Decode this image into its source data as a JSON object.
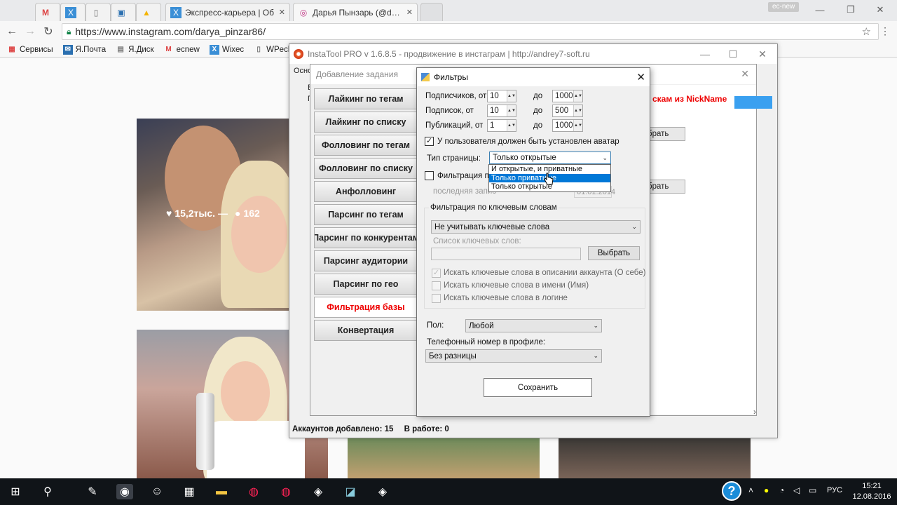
{
  "browser": {
    "tabs": [
      {
        "label": "",
        "icon": "gmail-icon"
      },
      {
        "label": "",
        "icon": "wix-icon"
      },
      {
        "label": "",
        "icon": "document-icon"
      },
      {
        "label": "",
        "icon": "screen-icon"
      },
      {
        "label": "",
        "icon": "drive-icon"
      },
      {
        "label": "Экспресс-карьера | Об",
        "icon": "wix-icon"
      },
      {
        "label": "Дарья Пынзарь (@darya",
        "icon": "instagram-icon"
      }
    ],
    "profile_badge": "ec-new",
    "url": "https://www.instagram.com/darya_pinzar86/",
    "bookmarks": [
      {
        "label": "Сервисы",
        "icon": "apps-icon"
      },
      {
        "label": "Я.Почта",
        "icon": "yandex-mail-icon"
      },
      {
        "label": "Я.Диск",
        "icon": "yandex-disk-icon"
      },
      {
        "label": "ecnew",
        "icon": "gmail-icon"
      },
      {
        "label": "Wixec",
        "icon": "wix-icon"
      },
      {
        "label": "WPecbiz",
        "icon": "document-icon"
      }
    ]
  },
  "instagram": {
    "photo1_likes": "15,2тыс. —",
    "photo1_comments": "162"
  },
  "instatool": {
    "title": "InstaTool PRO v 1.6.8.5 - продвижение в инстаграм | http://andrey7-soft.ru",
    "tabs_hint": "Осно",
    "status_accounts": "Аккаунтов добавлено: 15",
    "status_work": "В работе: 0"
  },
  "add_task": {
    "title": "Добавление задания",
    "buttons": [
      "Лайкинг по тегам",
      "Лайкинг по списку",
      "Фолловинг по тегам",
      "Фолловинг по списку",
      "Анфолловинг",
      "Парсинг по тегам",
      "Парсинг по конкурентам",
      "Парсинг аудитории",
      "Парсинг по гео",
      "Фильтрация базы",
      "Конвертация"
    ],
    "active_index": 9,
    "nick_label": "скам из NickName",
    "choose_label": "брать",
    "choose_label2": "брать",
    "left_letters_1": "В",
    "left_letters_2": "П"
  },
  "filters": {
    "title": "Фильтры",
    "followers_from_label": "Подписчиков, от",
    "followers_from": "10",
    "followers_to": "1000",
    "following_from_label": "Подписок, от",
    "following_from": "10",
    "following_to": "500",
    "posts_from_label": "Публикаций, от",
    "posts_from": "1",
    "posts_to": "1000",
    "to_label": "до",
    "avatar_label": "У пользователя должен быть установлен аватар",
    "page_type_label": "Тип страницы:",
    "page_type_value": "Только открытые",
    "page_type_options": [
      "И открытые, и приватные",
      "Только приватные",
      "Только открытые"
    ],
    "page_type_highlight": 1,
    "filter_date_label": "Фильтрация по",
    "last_post_label": "последняя запис",
    "last_post_date": "01.01.2014",
    "keywords_group": "Фильтрация по ключевым словам",
    "keywords_mode": "Не учитывать ключевые слова",
    "keywords_list_label": "Список ключевых слов:",
    "choose_button": "Выбрать",
    "kw_option_1": "Искать ключевые слова в описании аккаунта (О себе)",
    "kw_option_2": "Искать ключевые слова в имени (Имя)",
    "kw_option_3": "Искать ключевые слова в логине",
    "gender_label": "Пол:",
    "gender_value": "Любой",
    "phone_label": "Телефонный номер в профиле:",
    "phone_value": "Без разницы",
    "save_button": "Сохранить"
  },
  "taskbar": {
    "lang": "РУС",
    "time": "15:21",
    "date": "12.08.2016",
    "help": "?"
  }
}
